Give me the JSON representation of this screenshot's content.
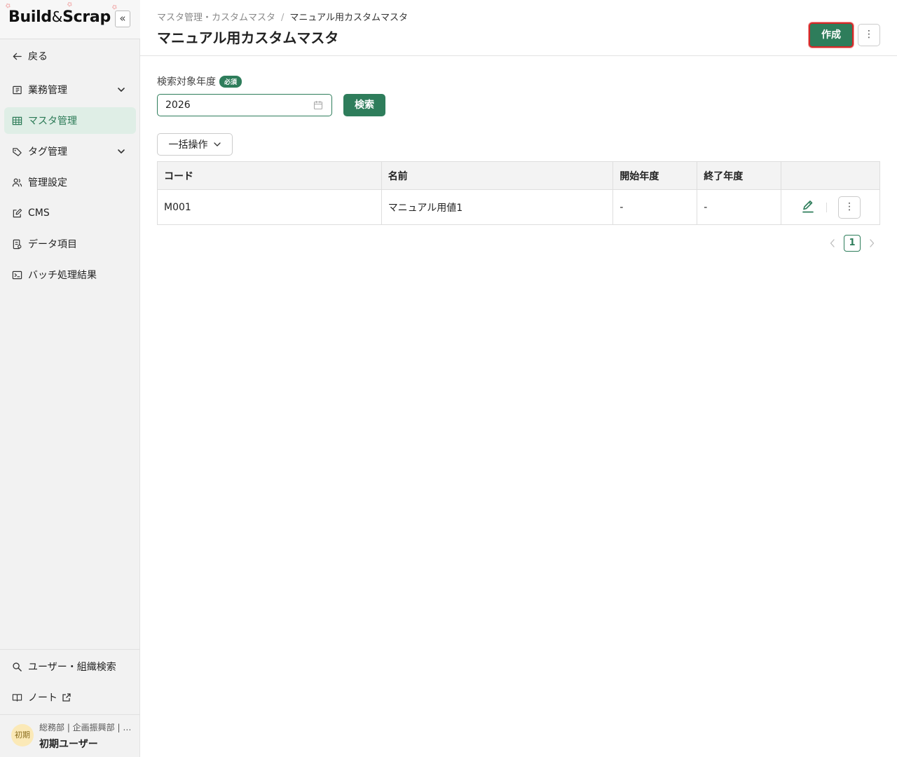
{
  "app": {
    "logo_left": "Build",
    "logo_amp": "&",
    "logo_right": "Scrap",
    "collapse_glyph": "«"
  },
  "sidebar": {
    "back_label": "戻る",
    "items": [
      {
        "label": "業務管理",
        "icon": "board-icon",
        "expandable": true
      },
      {
        "label": "マスタ管理",
        "icon": "table-icon",
        "active": true
      },
      {
        "label": "タグ管理",
        "icon": "tag-icon",
        "expandable": true
      },
      {
        "label": "管理設定",
        "icon": "users-icon"
      },
      {
        "label": "CMS",
        "icon": "edit-square-icon"
      },
      {
        "label": "データ項目",
        "icon": "document-icon"
      },
      {
        "label": "バッチ処理結果",
        "icon": "terminal-icon"
      }
    ],
    "bottom_items": [
      {
        "label": "ユーザー・組織検索",
        "icon": "search-icon"
      },
      {
        "label": "ノート",
        "icon": "book-icon"
      }
    ],
    "user": {
      "avatar_text": "初期",
      "dept": "総務部 | 企画振興部 | …",
      "name": "初期ユーザー"
    }
  },
  "header": {
    "breadcrumb": [
      "マスタ管理・カスタムマスタ",
      "マニュアル用カスタムマスタ"
    ],
    "breadcrumb_sep": "/",
    "title": "マニュアル用カスタムマスタ",
    "create_label": "作成",
    "more_glyph": "⋮"
  },
  "search": {
    "year_label": "検索対象年度",
    "required_badge": "必須",
    "year_value": "2026",
    "search_label": "検索"
  },
  "bulk": {
    "label": "一括操作"
  },
  "table": {
    "columns": [
      "コード",
      "名前",
      "開始年度",
      "終了年度",
      ""
    ],
    "rows": [
      {
        "code": "M001",
        "name": "マニュアル用値1",
        "start": "-",
        "end": "-"
      }
    ]
  },
  "pager": {
    "current": "1"
  },
  "colors": {
    "primary": "#2e7d5b",
    "highlight": "#d62828",
    "active_bg": "#dfeee6"
  }
}
